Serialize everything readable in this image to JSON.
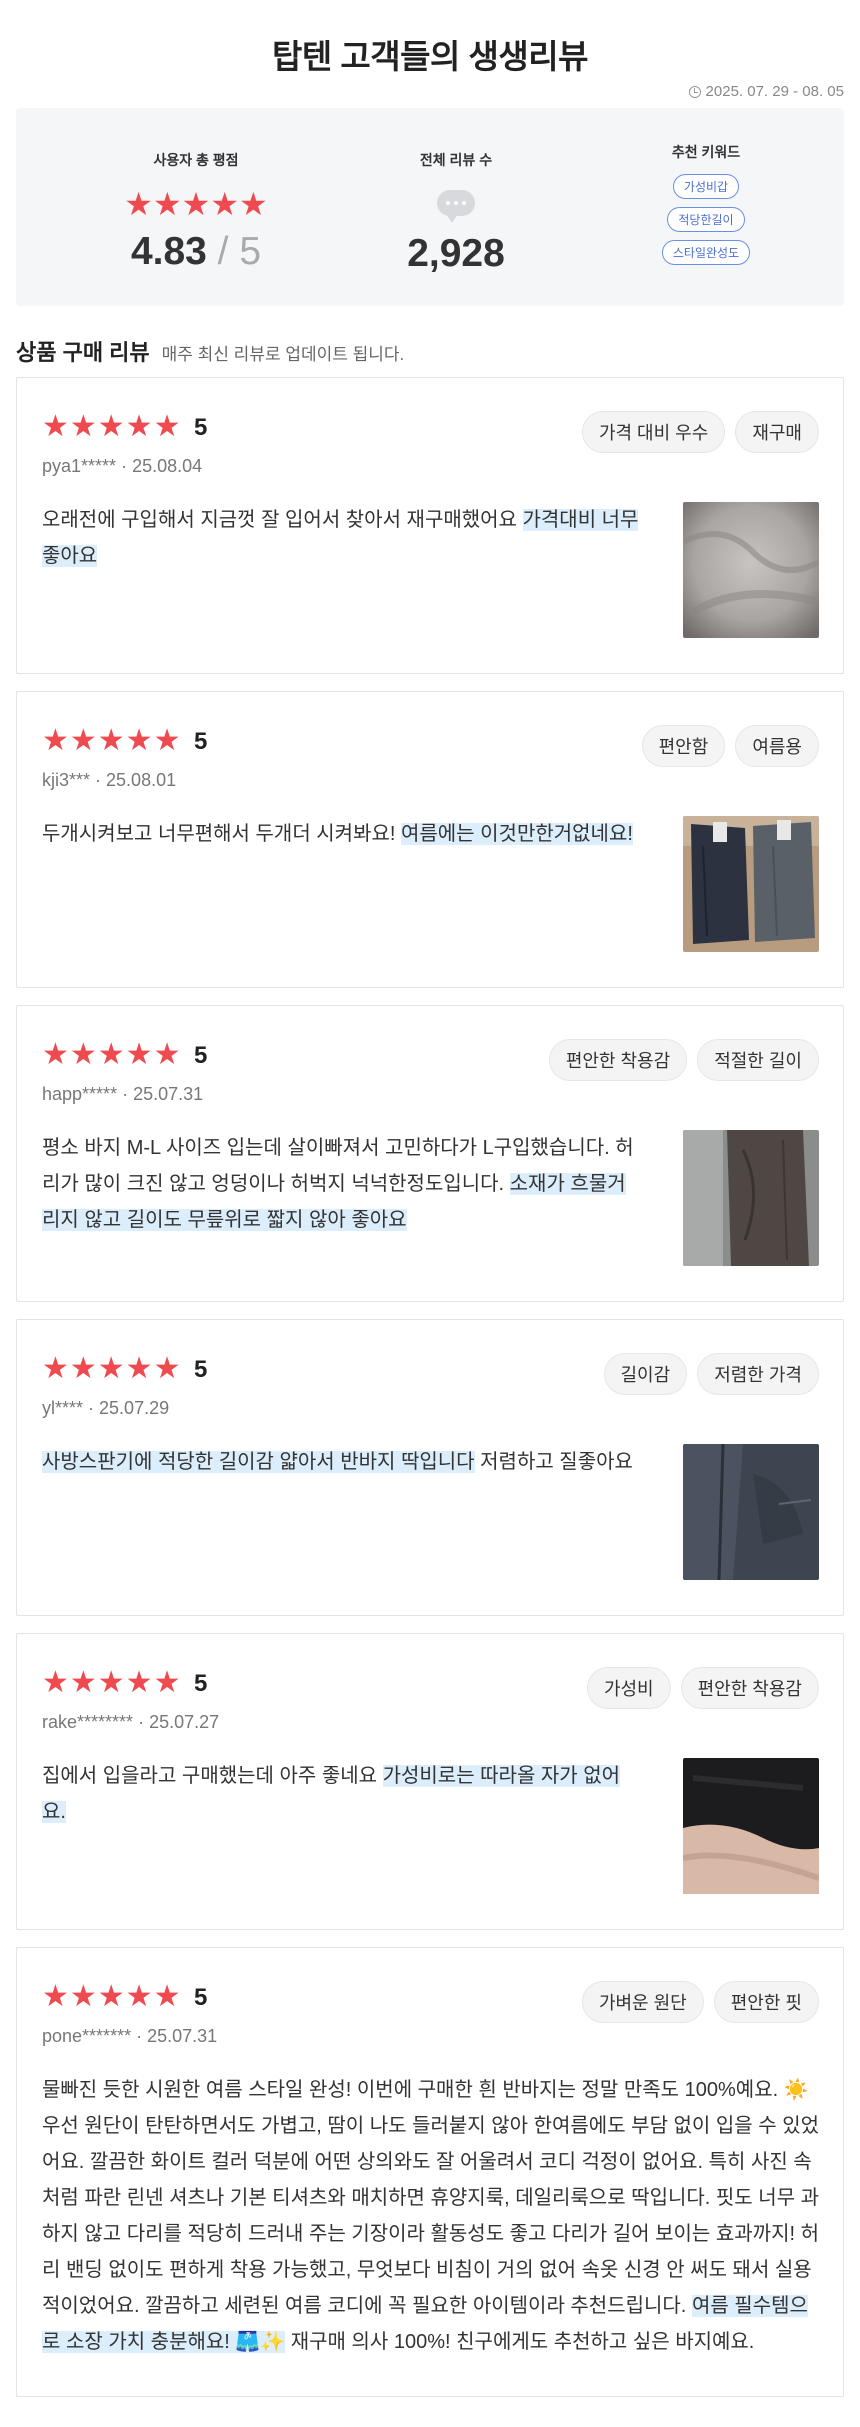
{
  "header": {
    "title": "탑텐 고객들의 생생리뷰",
    "period": "2025. 07. 29 - 08. 05"
  },
  "summary": {
    "rating_label": "사용자 총 평점",
    "rating_stars": "★★★★★",
    "rating_value": "4.83",
    "rating_max": "5",
    "count_label": "전체 리뷰 수",
    "count_value": "2,928",
    "keyword_label": "추천 키워드",
    "keywords": [
      "가성비갑",
      "적당한길이",
      "스타일완성도"
    ]
  },
  "section": {
    "title": "상품 구매 리뷰",
    "subtitle": "매주 최신 리뷰로 업데이트 됩니다."
  },
  "reviews": [
    {
      "stars": "★★★★★",
      "rating": "5",
      "user": "pya1*****",
      "date": "25.08.04",
      "tags": [
        "가격 대비 우수",
        "재구매"
      ],
      "text": "오래전에 구입해서 지금껏 잘 입어서 찾아서 재구매했어요 ",
      "highlight": "가격대비 너무 좋아요",
      "text_after": ""
    },
    {
      "stars": "★★★★★",
      "rating": "5",
      "user": "kji3***",
      "date": "25.08.01",
      "tags": [
        "편안함",
        "여름용"
      ],
      "text": "두개시켜보고 너무편해서 두개더 시켜봐요! ",
      "highlight": "여름에는 이것만한거없네요!",
      "text_after": ""
    },
    {
      "stars": "★★★★★",
      "rating": "5",
      "user": "happ*****",
      "date": "25.07.31",
      "tags": [
        "편안한 착용감",
        "적절한 길이"
      ],
      "text": "평소 바지 M-L 사이즈 입는데 살이빠져서 고민하다가 L구입했습니다. 허리가 많이 크진 않고 엉덩이나 허벅지 넉넉한정도입니다. ",
      "highlight": "소재가 흐물거리지 않고 길이도 무릎위로 짧지 않아 좋아요",
      "text_after": ""
    },
    {
      "stars": "★★★★★",
      "rating": "5",
      "user": "yl****",
      "date": "25.07.29",
      "tags": [
        "길이감",
        "저렴한 가격"
      ],
      "text": "",
      "highlight": "사방스판기에 적당한 길이감 얇아서 반바지 딱입니다",
      "text_after": " 저렴하고 질좋아요"
    },
    {
      "stars": "★★★★★",
      "rating": "5",
      "user": "rake********",
      "date": "25.07.27",
      "tags": [
        "가성비",
        "편안한 착용감"
      ],
      "text": "집에서 입을라고 구매했는데 아주 좋네요 ",
      "highlight": "가성비로는 따라올 자가 없어요.",
      "text_after": ""
    },
    {
      "stars": "★★★★★",
      "rating": "5",
      "user": "pone*******",
      "date": "25.07.31",
      "tags": [
        "가벼운 원단",
        "편안한 핏"
      ],
      "text": "물빠진 듯한 시원한 여름 스타일 완성! 이번에 구매한 흰 반바지는 정말 만족도 100%예요. ☀️ 우선 원단이 탄탄하면서도 가볍고, 땀이 나도 들러붙지 않아 한여름에도 부담 없이 입을 수 있었어요. 깔끔한 화이트 컬러 덕분에 어떤 상의와도 잘 어울려서 코디 걱정이 없어요. 특히 사진 속처럼 파란 린넨 셔츠나 기본 티셔츠와 매치하면 휴양지룩, 데일리룩으로 딱입니다. 핏도 너무 과하지 않고 다리를 적당히 드러내 주는 기장이라 활동성도 좋고 다리가 길어 보이는 효과까지! 허리 밴딩 없이도 편하게 착용 가능했고, 무엇보다 비침이 거의 없어 속옷 신경 안 써도 돼서 실용적이었어요. 깔끔하고 세련된 여름 코디에 꼭 필요한 아이템이라 추천드립니다. ",
      "highlight": "여름 필수템으로 소장 가치 충분해요! 🩳✨",
      "text_after": " 재구매 의사 100%! 친구에게도 추천하고 싶은 바지예요."
    }
  ]
}
